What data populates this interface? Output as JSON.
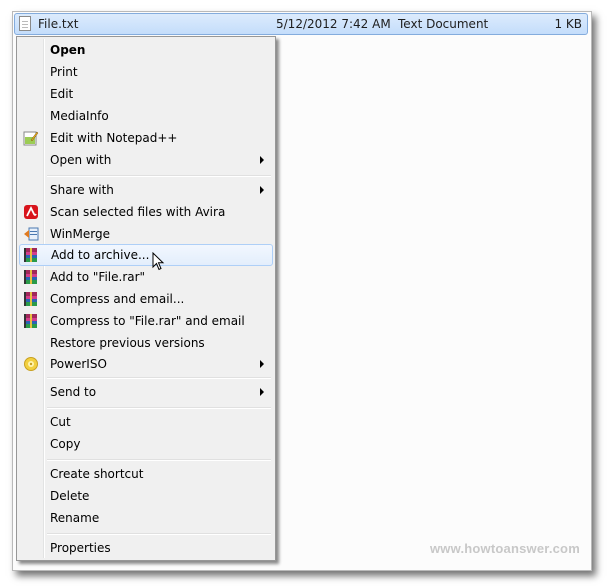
{
  "file": {
    "name": "File.txt",
    "date_modified": "5/12/2012 7:42 AM",
    "type": "Text Document",
    "size": "1 KB"
  },
  "menu": {
    "items": [
      {
        "label": "Open",
        "bold": true,
        "icon": null,
        "submenu": false
      },
      {
        "label": "Print",
        "icon": null,
        "submenu": false
      },
      {
        "label": "Edit",
        "icon": null,
        "submenu": false
      },
      {
        "label": "MediaInfo",
        "icon": null,
        "submenu": false
      },
      {
        "label": "Edit with Notepad++",
        "icon": "notepadpp-icon",
        "submenu": false
      },
      {
        "label": "Open with",
        "icon": null,
        "submenu": true
      },
      {
        "label": "Share with",
        "icon": null,
        "submenu": true
      },
      {
        "label": "Scan selected files with Avira",
        "icon": "avira-icon",
        "submenu": false
      },
      {
        "label": "WinMerge",
        "icon": "winmerge-icon",
        "submenu": false
      },
      {
        "label": "Add to archive...",
        "icon": "winrar-icon",
        "submenu": false,
        "hovered": true
      },
      {
        "label": "Add to \"File.rar\"",
        "icon": "winrar-icon",
        "submenu": false
      },
      {
        "label": "Compress and email...",
        "icon": "winrar-icon",
        "submenu": false
      },
      {
        "label": "Compress to \"File.rar\" and email",
        "icon": "winrar-icon",
        "submenu": false
      },
      {
        "label": "Restore previous versions",
        "icon": null,
        "submenu": false
      },
      {
        "label": "PowerISO",
        "icon": "poweriso-icon",
        "submenu": true
      },
      {
        "label": "Send to",
        "icon": null,
        "submenu": true
      },
      {
        "label": "Cut",
        "icon": null,
        "submenu": false
      },
      {
        "label": "Copy",
        "icon": null,
        "submenu": false
      },
      {
        "label": "Create shortcut",
        "icon": null,
        "submenu": false
      },
      {
        "label": "Delete",
        "icon": null,
        "submenu": false
      },
      {
        "label": "Rename",
        "icon": null,
        "submenu": false
      },
      {
        "label": "Properties",
        "icon": null,
        "submenu": false
      }
    ]
  },
  "watermark": "www.howtoanswer.com",
  "colors": {
    "selection_bg": "#cce0f9",
    "selection_border": "#84acdd",
    "menu_bg": "#f0f0f0",
    "hover_border": "#aecff7"
  }
}
